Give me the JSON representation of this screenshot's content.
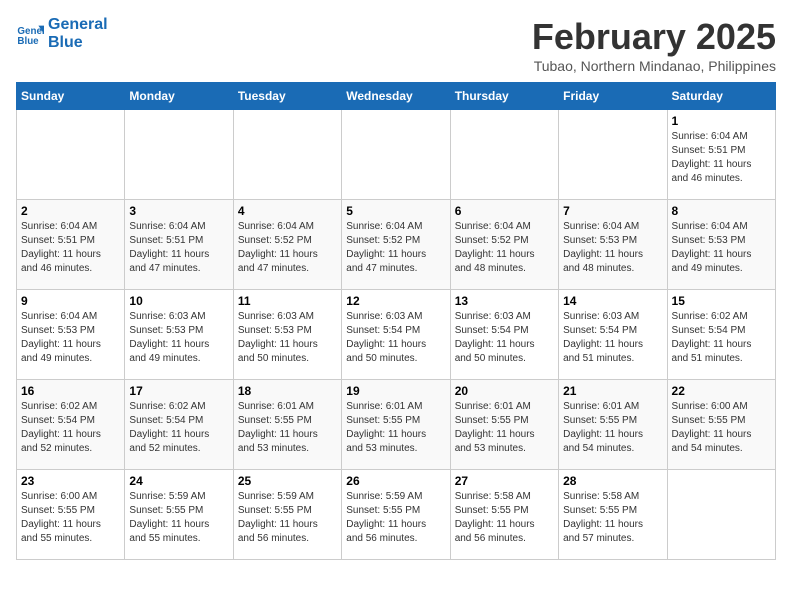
{
  "header": {
    "logo_line1": "General",
    "logo_line2": "Blue",
    "title": "February 2025",
    "subtitle": "Tubao, Northern Mindanao, Philippines"
  },
  "weekdays": [
    "Sunday",
    "Monday",
    "Tuesday",
    "Wednesday",
    "Thursday",
    "Friday",
    "Saturday"
  ],
  "weeks": [
    [
      {
        "day": "",
        "info": ""
      },
      {
        "day": "",
        "info": ""
      },
      {
        "day": "",
        "info": ""
      },
      {
        "day": "",
        "info": ""
      },
      {
        "day": "",
        "info": ""
      },
      {
        "day": "",
        "info": ""
      },
      {
        "day": "1",
        "info": "Sunrise: 6:04 AM\nSunset: 5:51 PM\nDaylight: 11 hours\nand 46 minutes."
      }
    ],
    [
      {
        "day": "2",
        "info": "Sunrise: 6:04 AM\nSunset: 5:51 PM\nDaylight: 11 hours\nand 46 minutes."
      },
      {
        "day": "3",
        "info": "Sunrise: 6:04 AM\nSunset: 5:51 PM\nDaylight: 11 hours\nand 47 minutes."
      },
      {
        "day": "4",
        "info": "Sunrise: 6:04 AM\nSunset: 5:52 PM\nDaylight: 11 hours\nand 47 minutes."
      },
      {
        "day": "5",
        "info": "Sunrise: 6:04 AM\nSunset: 5:52 PM\nDaylight: 11 hours\nand 47 minutes."
      },
      {
        "day": "6",
        "info": "Sunrise: 6:04 AM\nSunset: 5:52 PM\nDaylight: 11 hours\nand 48 minutes."
      },
      {
        "day": "7",
        "info": "Sunrise: 6:04 AM\nSunset: 5:53 PM\nDaylight: 11 hours\nand 48 minutes."
      },
      {
        "day": "8",
        "info": "Sunrise: 6:04 AM\nSunset: 5:53 PM\nDaylight: 11 hours\nand 49 minutes."
      }
    ],
    [
      {
        "day": "9",
        "info": "Sunrise: 6:04 AM\nSunset: 5:53 PM\nDaylight: 11 hours\nand 49 minutes."
      },
      {
        "day": "10",
        "info": "Sunrise: 6:03 AM\nSunset: 5:53 PM\nDaylight: 11 hours\nand 49 minutes."
      },
      {
        "day": "11",
        "info": "Sunrise: 6:03 AM\nSunset: 5:53 PM\nDaylight: 11 hours\nand 50 minutes."
      },
      {
        "day": "12",
        "info": "Sunrise: 6:03 AM\nSunset: 5:54 PM\nDaylight: 11 hours\nand 50 minutes."
      },
      {
        "day": "13",
        "info": "Sunrise: 6:03 AM\nSunset: 5:54 PM\nDaylight: 11 hours\nand 50 minutes."
      },
      {
        "day": "14",
        "info": "Sunrise: 6:03 AM\nSunset: 5:54 PM\nDaylight: 11 hours\nand 51 minutes."
      },
      {
        "day": "15",
        "info": "Sunrise: 6:02 AM\nSunset: 5:54 PM\nDaylight: 11 hours\nand 51 minutes."
      }
    ],
    [
      {
        "day": "16",
        "info": "Sunrise: 6:02 AM\nSunset: 5:54 PM\nDaylight: 11 hours\nand 52 minutes."
      },
      {
        "day": "17",
        "info": "Sunrise: 6:02 AM\nSunset: 5:54 PM\nDaylight: 11 hours\nand 52 minutes."
      },
      {
        "day": "18",
        "info": "Sunrise: 6:01 AM\nSunset: 5:55 PM\nDaylight: 11 hours\nand 53 minutes."
      },
      {
        "day": "19",
        "info": "Sunrise: 6:01 AM\nSunset: 5:55 PM\nDaylight: 11 hours\nand 53 minutes."
      },
      {
        "day": "20",
        "info": "Sunrise: 6:01 AM\nSunset: 5:55 PM\nDaylight: 11 hours\nand 53 minutes."
      },
      {
        "day": "21",
        "info": "Sunrise: 6:01 AM\nSunset: 5:55 PM\nDaylight: 11 hours\nand 54 minutes."
      },
      {
        "day": "22",
        "info": "Sunrise: 6:00 AM\nSunset: 5:55 PM\nDaylight: 11 hours\nand 54 minutes."
      }
    ],
    [
      {
        "day": "23",
        "info": "Sunrise: 6:00 AM\nSunset: 5:55 PM\nDaylight: 11 hours\nand 55 minutes."
      },
      {
        "day": "24",
        "info": "Sunrise: 5:59 AM\nSunset: 5:55 PM\nDaylight: 11 hours\nand 55 minutes."
      },
      {
        "day": "25",
        "info": "Sunrise: 5:59 AM\nSunset: 5:55 PM\nDaylight: 11 hours\nand 56 minutes."
      },
      {
        "day": "26",
        "info": "Sunrise: 5:59 AM\nSunset: 5:55 PM\nDaylight: 11 hours\nand 56 minutes."
      },
      {
        "day": "27",
        "info": "Sunrise: 5:58 AM\nSunset: 5:55 PM\nDaylight: 11 hours\nand 56 minutes."
      },
      {
        "day": "28",
        "info": "Sunrise: 5:58 AM\nSunset: 5:55 PM\nDaylight: 11 hours\nand 57 minutes."
      },
      {
        "day": "",
        "info": ""
      }
    ]
  ]
}
